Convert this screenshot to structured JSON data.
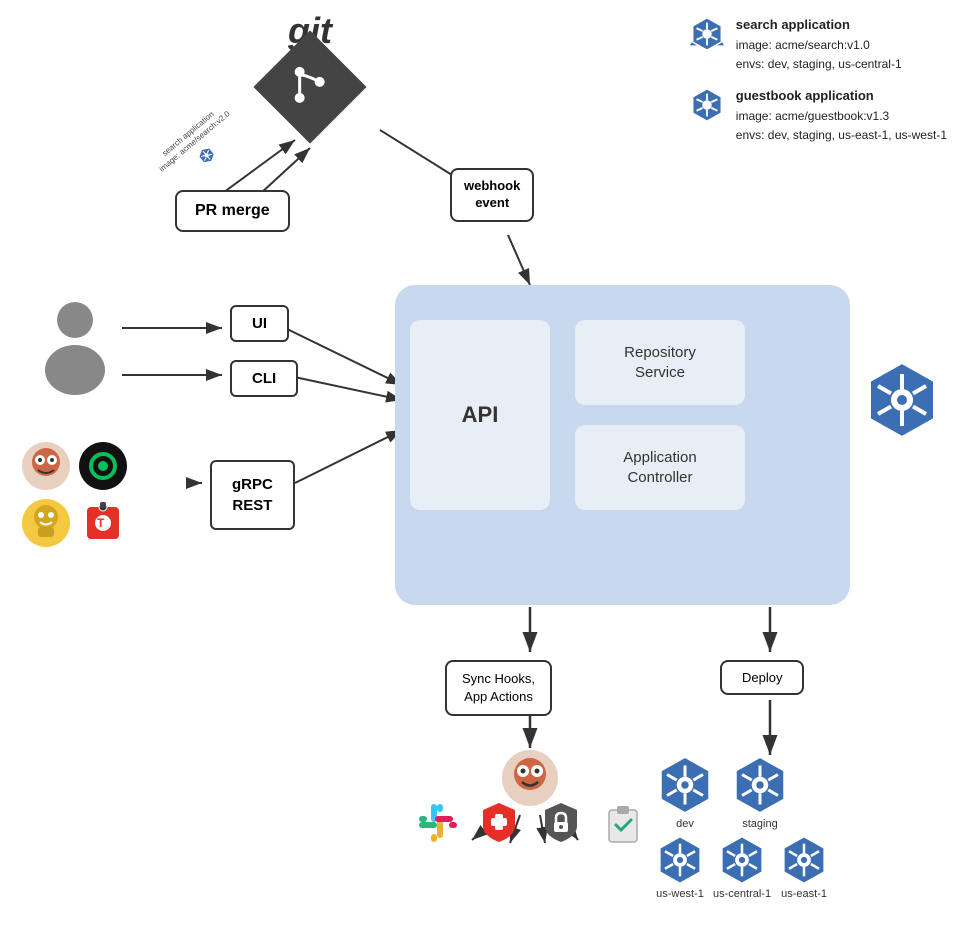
{
  "git": {
    "text": "git",
    "logo_alt": "git logo with branch icon"
  },
  "apps": {
    "search": {
      "name": "search application",
      "image": "image: acme/search:v1.0",
      "envs": "envs: dev, staging, us-central-1"
    },
    "guestbook": {
      "name": "guestbook application",
      "image": "image: acme/guestbook:v1.3",
      "envs": "envs: dev, staging, us-east-1, us-west-1"
    }
  },
  "pr_merge": {
    "label": "PR merge",
    "search_app_label": "search application",
    "search_app_image": "image: acme/search:v2.0"
  },
  "webhook": {
    "label": "webhook\nevent"
  },
  "interfaces": {
    "ui": "UI",
    "cli": "CLI",
    "grpc_rest": "gRPC\nREST"
  },
  "system_box": {
    "api": "API",
    "repo_service": "Repository\nService",
    "app_controller": "Application\nController"
  },
  "bottom": {
    "sync_hooks": "Sync Hooks,\nApp Actions",
    "deploy": "Deploy"
  },
  "k8s_labels": {
    "dev": "dev",
    "staging": "staging",
    "us_west_1": "us-west-1",
    "us_central_1": "us-central-1",
    "us_east_1": "us-east-1"
  }
}
